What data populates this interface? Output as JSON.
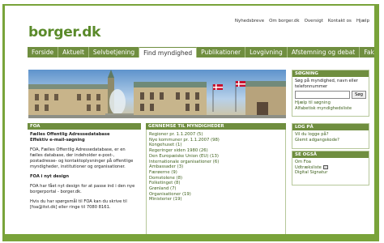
{
  "header": {
    "logo": "borger.dk",
    "top_links": [
      "Nyhedsbreve",
      "Om borger.dk",
      "Oversigt",
      "Kontakt os",
      "Hjælp"
    ]
  },
  "nav": {
    "tabs": [
      "Forside",
      "Aktuelt",
      "Selvbetjening",
      "Find myndighed",
      "Publikationer",
      "Lovgivning",
      "Afstemning og debat",
      "Fakta om Danmark"
    ],
    "active": "Find myndighed"
  },
  "foa": {
    "header": "FOA",
    "title1": "Fælles Offentlig Adressedatabase",
    "title2": "Effektiv e-mail-søgning",
    "paragraph1": "FOA, Fælles Offentlig Adressedatabase, er en fælles database, der indeholder e-post-, postadresse- og kontaktoplysninger på offentlige myndigheder, institutioner og organisationer.",
    "subheading": "FOA i nyt design",
    "paragraph2": "FOA har fået nyt design for at passe ind i den nye borgerportal - borger.dk.",
    "paragraph3": "Hvis du har spørgsmål til FOA kan du skrive til [foa@itst.dk] eller ringe til 7080 8161."
  },
  "myndigheder": {
    "header": "GENNEMSE TIL MYNDIGHEDER",
    "items": [
      "Regioner pr. 1.1.2007 (5)",
      "Nye kommuner pr. 1.1.2007 (98)",
      "Kongehuset (1)",
      "Regeringer siden 1980 (26)",
      "Den Europæiske Union (EU) (13)",
      "Internationale organisationer (6)",
      "Ambassader (3)",
      "Færøerne (9)",
      "Domstolene (8)",
      "Folketinget (8)",
      "Grønland (7)",
      "Organisationer (19)",
      "Ministerier (19)"
    ]
  },
  "search": {
    "header": "SØGNING",
    "desc": "Søg på myndighed, navn eller telefonnummer",
    "button": "Søg",
    "help_link": "Hjælp til søgning",
    "alpha_link": "Alfabetisk myndighedsliste"
  },
  "login": {
    "header": "LOG PÅ",
    "link1": "Vil du logge på?",
    "link2": "Glemt adgangskode?"
  },
  "see_also": {
    "header": "SE OGSÅ",
    "items": [
      "Om Foa",
      "Udtræksliste",
      "Digital Signatur"
    ]
  },
  "colors": {
    "frame": "#79a33a",
    "nav": "#6f8e3f",
    "logo": "#5a8a2a"
  }
}
